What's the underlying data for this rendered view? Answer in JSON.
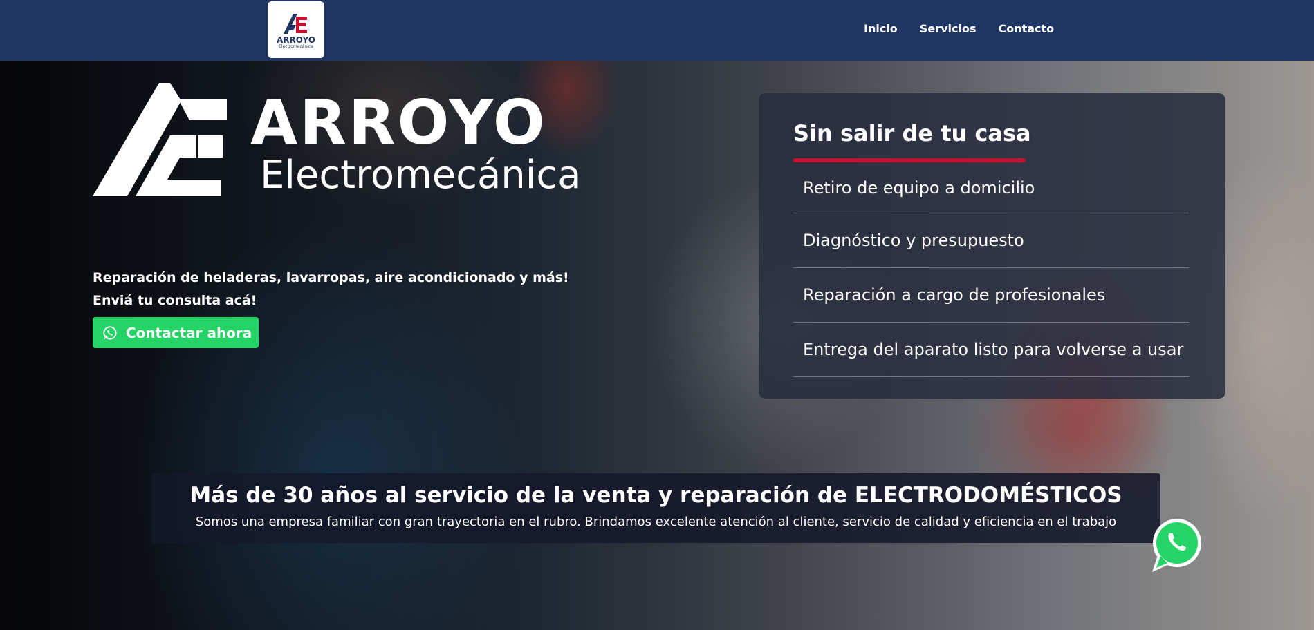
{
  "nav": {
    "logo": {
      "name": "ARROYO",
      "subtitle": "Electromecánica"
    },
    "links": [
      {
        "label": "Inicio"
      },
      {
        "label": "Servicios"
      },
      {
        "label": "Contacto"
      }
    ]
  },
  "hero": {
    "logo_name": "ARROYO",
    "logo_subtitle": "Electromecánica",
    "tagline_line1": "Reparación de heladeras, lavarropas, aire acondicionado y más!",
    "tagline_line2": "Enviá tu consulta acá!",
    "cta_label": "Contactar ahora",
    "cta_icon": "whatsapp-icon"
  },
  "panel": {
    "title": "Sin salir de tu casa",
    "items": [
      {
        "label": "Retiro de equipo a domicilio"
      },
      {
        "label": "Diagnóstico y presupuesto"
      },
      {
        "label": "Reparación a cargo de profesionales"
      },
      {
        "label": "Entrega del aparato listo para volverse a usar"
      }
    ]
  },
  "banner": {
    "title": "Más de 30 años al servicio de la venta y reparación de ELECTRODOMÉSTICOS",
    "subtitle": "Somos una empresa familiar con gran trayectoria en el rubro. Brindamos excelente atención al cliente, servicio de calidad y eficiencia en el trabajo"
  },
  "floating": {
    "icon": "whatsapp-icon"
  },
  "colors": {
    "navbar": "#1f3563",
    "accent_red": "#c8102e",
    "whatsapp_green": "#25d366",
    "panel_bg": "#282c3e",
    "banner_bg": "#14182a"
  }
}
